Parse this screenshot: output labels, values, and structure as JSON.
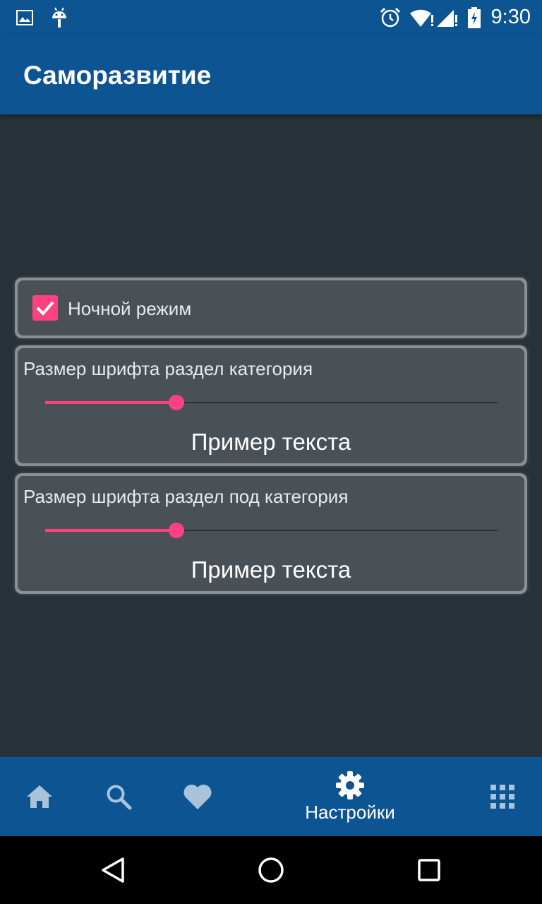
{
  "status_bar": {
    "time": "9:30",
    "icons": [
      "gallery-icon",
      "android-icon",
      "alarm-icon",
      "wifi-icon",
      "signal-icon",
      "battery-icon"
    ]
  },
  "app_bar": {
    "title": "Саморазвитие"
  },
  "settings": {
    "night_mode": {
      "label": "Ночной режим",
      "checked": true
    },
    "category_font": {
      "label": "Размер шрифта раздел категория",
      "value": 0.29,
      "sample": "Пример текста"
    },
    "subcategory_font": {
      "label": "Размер шрифта раздел под категория",
      "value": 0.29,
      "sample": "Пример текста"
    }
  },
  "bottom_nav": {
    "items": [
      {
        "icon": "home-icon",
        "label": ""
      },
      {
        "icon": "search-icon",
        "label": ""
      },
      {
        "icon": "heart-icon",
        "label": ""
      },
      {
        "icon": "gear-icon",
        "label": "Настройки",
        "active": true
      },
      {
        "icon": "grid-icon",
        "label": ""
      }
    ]
  },
  "colors": {
    "primary": "#0d5492",
    "background": "#273238",
    "card": "#495157",
    "accent": "#ff4081",
    "inactive_icon": "#a9c3dc"
  }
}
